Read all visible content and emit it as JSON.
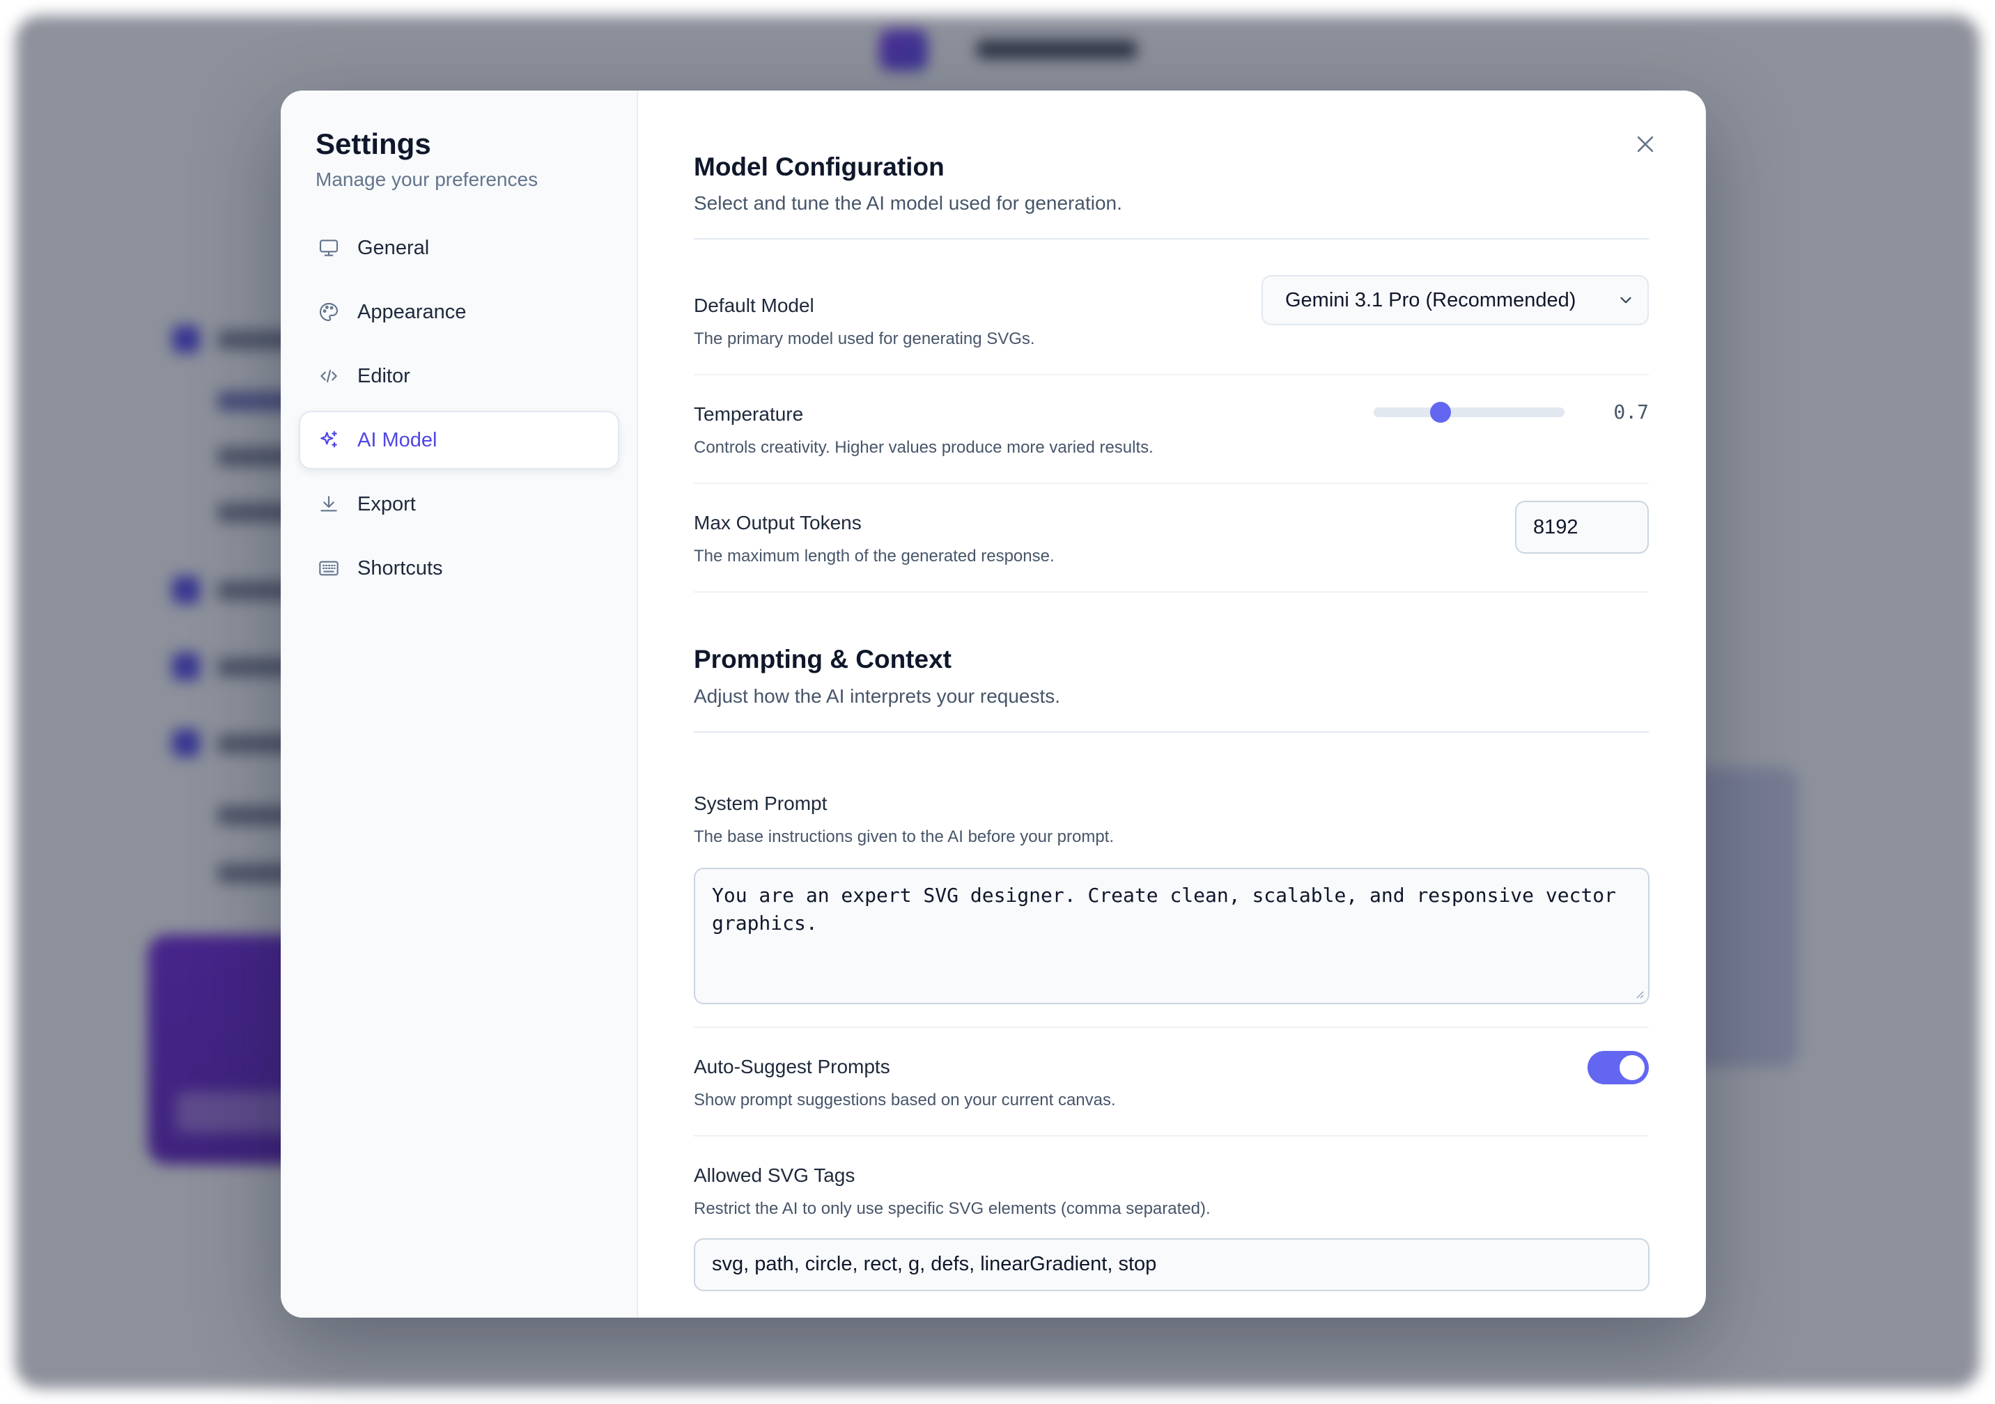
{
  "sidebar": {
    "title": "Settings",
    "subtitle": "Manage your preferences",
    "items": [
      {
        "label": "General",
        "icon": "monitor-icon",
        "active": false
      },
      {
        "label": "Appearance",
        "icon": "palette-icon",
        "active": false
      },
      {
        "label": "Editor",
        "icon": "code-icon",
        "active": false
      },
      {
        "label": "AI Model",
        "icon": "sparkles-icon",
        "active": true
      },
      {
        "label": "Export",
        "icon": "download-icon",
        "active": false
      },
      {
        "label": "Shortcuts",
        "icon": "keyboard-icon",
        "active": false
      }
    ]
  },
  "model_config": {
    "title": "Model Configuration",
    "description": "Select and tune the AI model used for generation.",
    "default_model": {
      "label": "Default Model",
      "help": "The primary model used for generating SVGs.",
      "value": "Gemini 3.1 Pro (Recommended)"
    },
    "temperature": {
      "label": "Temperature",
      "help": "Controls creativity. Higher values produce more varied results.",
      "value": 0.7,
      "display": "0.7",
      "min": 0,
      "max": 2
    },
    "max_tokens": {
      "label": "Max Output Tokens",
      "help": "The maximum length of the generated response.",
      "value": "8192"
    }
  },
  "prompting": {
    "title": "Prompting & Context",
    "description": "Adjust how the AI interprets your requests.",
    "system_prompt": {
      "label": "System Prompt",
      "help": "The base instructions given to the AI before your prompt.",
      "value": "You are an expert SVG designer. Create clean, scalable, and responsive vector graphics."
    },
    "auto_suggest": {
      "label": "Auto-Suggest Prompts",
      "help": "Show prompt suggestions based on your current canvas.",
      "enabled": true
    },
    "allowed_tags": {
      "label": "Allowed SVG Tags",
      "help": "Restrict the AI to only use specific SVG elements (comma separated).",
      "value": "svg, path, circle, rect, g, defs, linearGradient, stop"
    }
  },
  "colors": {
    "accent": "#6366f1",
    "active_text": "#4f46e5"
  }
}
